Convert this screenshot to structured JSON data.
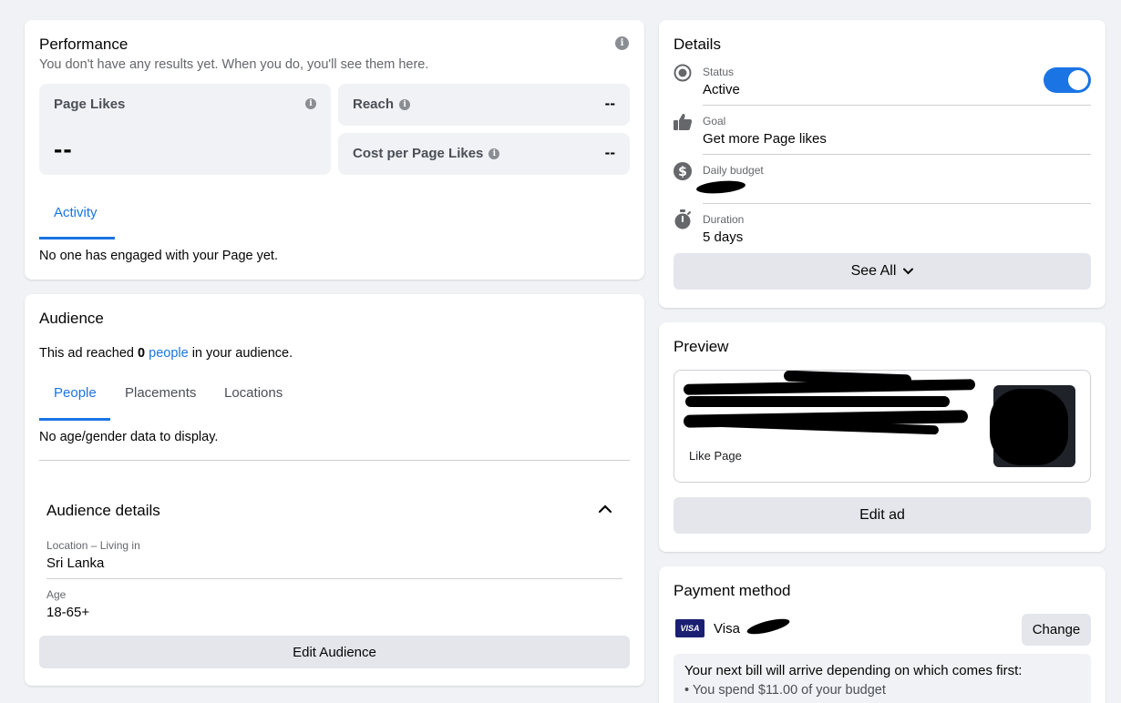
{
  "performance": {
    "title": "Performance",
    "subtitle": "You don't have any results yet. When you do, you'll see them here.",
    "page_likes_label": "Page Likes",
    "page_likes_value": "--",
    "reach_label": "Reach",
    "reach_value": "--",
    "cost_label": "Cost per Page Likes",
    "cost_value": "--",
    "activity_tab": "Activity",
    "activity_empty": "No one has engaged with your Page yet."
  },
  "audience": {
    "title": "Audience",
    "reached_prefix": "This ad reached ",
    "reached_count": "0",
    "reached_link": "people",
    "reached_suffix": " in your audience.",
    "tabs": [
      "People",
      "Placements",
      "Locations"
    ],
    "empty": "No age/gender data to display.",
    "details_title": "Audience details",
    "location_label": "Location – Living in",
    "location_value": "Sri Lanka",
    "age_label": "Age",
    "age_value": "18-65+",
    "edit_button": "Edit Audience"
  },
  "details": {
    "title": "Details",
    "status_label": "Status",
    "status_value": "Active",
    "status_on": true,
    "goal_label": "Goal",
    "goal_value": "Get more Page likes",
    "budget_label": "Daily budget",
    "duration_label": "Duration",
    "duration_value": "5 days",
    "see_all": "See All"
  },
  "preview": {
    "title": "Preview",
    "like_page": "Like Page",
    "edit_button": "Edit ad"
  },
  "payment": {
    "title": "Payment method",
    "card_brand_badge": "VISA",
    "card_name": "Visa",
    "change_button": "Change",
    "bill_note": "Your next bill will arrive depending on which comes first:",
    "bill_item": "You spend $11.00 of your budget"
  },
  "colors": {
    "accent": "#1b74e4",
    "background": "#f0f2f5",
    "visa": "#1a1f71"
  }
}
